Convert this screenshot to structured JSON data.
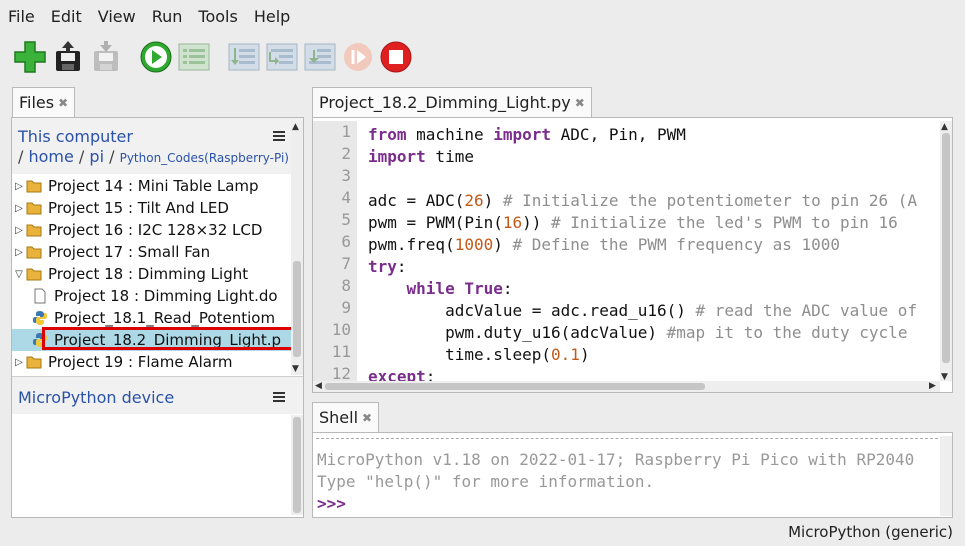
{
  "menubar": [
    "File",
    "Edit",
    "View",
    "Run",
    "Tools",
    "Help"
  ],
  "toolbar": {
    "new_icon": "new-file-icon",
    "open_icon": "load-icon",
    "save_icon": "save-icon",
    "run_icon": "run-icon",
    "debug_icon": "debug-icon",
    "step_over_icon": "step-over-icon",
    "step_into_icon": "step-into-icon",
    "step_out_icon": "step-out-icon",
    "resume_icon": "resume-icon",
    "stop_icon": "stop-icon"
  },
  "files": {
    "tab_label": "Files",
    "this_computer": "This computer",
    "path": {
      "seg1": "home",
      "seg2": "pi",
      "seg3": "Python_Codes(Raspberry-Pi)"
    },
    "items": [
      {
        "label": "Project 14 : Mini Table Lamp"
      },
      {
        "label": "Project 15 : Tilt And LED"
      },
      {
        "label": "Project 16 :  I2C 128×32 LCD"
      },
      {
        "label": "Project 17 : Small Fan"
      },
      {
        "label": "Project 18 : Dimming Light"
      },
      {
        "label": "Project 18 : Dimming Light.do"
      },
      {
        "label": "Project_18.1_Read_Potentiom"
      },
      {
        "label": "Project_18.2_Dimming_Light.p"
      },
      {
        "label": "Project 19 : Flame Alarm"
      }
    ],
    "micropython_device": "MicroPython device"
  },
  "editor": {
    "tab_label": "Project_18.2_Dimming_Light.py",
    "line_numbers": [
      "1",
      "2",
      "3",
      "4",
      "5",
      "6",
      "7",
      "8",
      "9",
      "10",
      "11",
      "12"
    ],
    "lines": {
      "l1": {
        "a": "from",
        "b": " machine ",
        "c": "import",
        "d": " ADC, Pin, PWM"
      },
      "l2": {
        "a": "import",
        "b": " time"
      },
      "l4": {
        "a": "adc = ADC(",
        "b": "26",
        "c": ") ",
        "d": "# Initialize the potentiometer to pin 26 (A"
      },
      "l5": {
        "a": "pwm = PWM(Pin(",
        "b": "16",
        "c": ")) ",
        "d": "# Initialize the led's PWM to pin 16"
      },
      "l6": {
        "a": "pwm.freq(",
        "b": "1000",
        "c": ") ",
        "d": "# Define the PWM frequency as 1000"
      },
      "l7": {
        "a": "try",
        "b": ":"
      },
      "l8": {
        "a": "    ",
        "b": "while",
        "c": " ",
        "d": "True",
        "e": ":"
      },
      "l9": {
        "a": "        adcValue = adc.read_u16() ",
        "b": "# read the ADC value of"
      },
      "l10": {
        "a": "        pwm.duty_u16(adcValue) ",
        "b": "#map it to the duty cycle"
      },
      "l11": {
        "a": "        time.sleep(",
        "b": "0.1",
        "c": ")"
      },
      "l12": {
        "a": "except",
        "b": ":"
      }
    }
  },
  "shell": {
    "tab_label": "Shell",
    "line1": "MicroPython v1.18 on 2022-01-17; Raspberry Pi Pico with RP2040",
    "line2": "Type \"help()\" for more information.",
    "prompt": ">>>"
  },
  "status": {
    "interpreter": "MicroPython (generic)"
  }
}
